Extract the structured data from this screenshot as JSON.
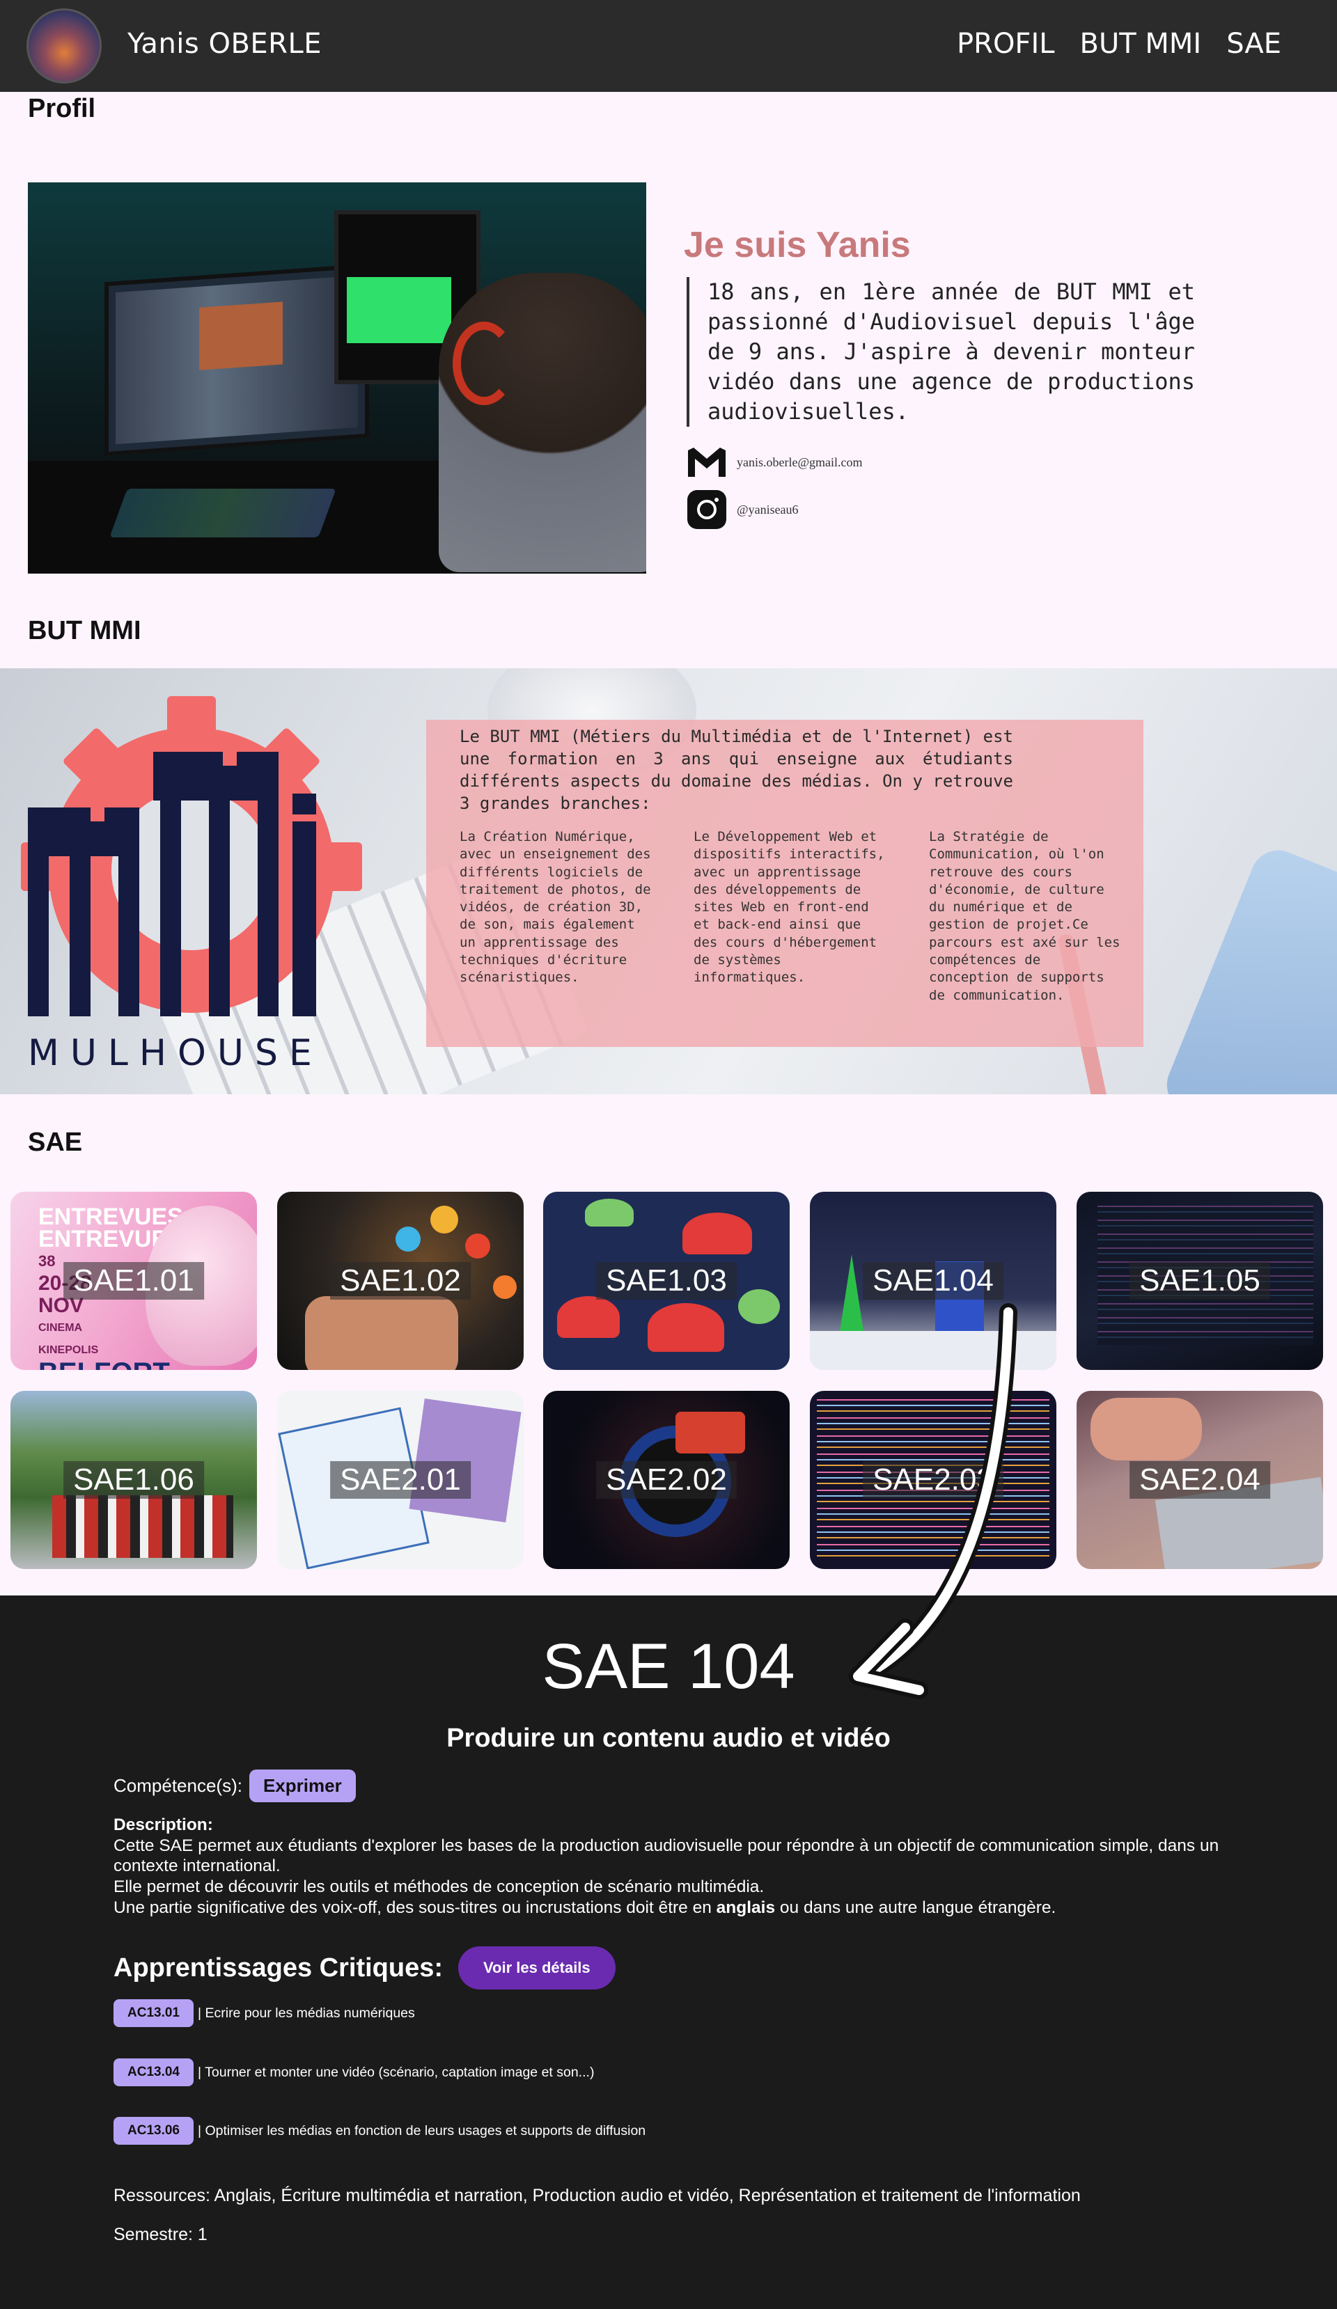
{
  "header": {
    "brand": "Yanis OBERLE",
    "nav": [
      "PROFIL",
      "BUT MMI",
      "SAE"
    ]
  },
  "profil": {
    "section_title": "Profil",
    "intro_title": "Je suis Yanis",
    "intro_text": "18 ans, en 1ère année de BUT MMI et passionné d'Audiovisuel depuis l'âge de 9 ans. J'aspire à devenir monteur vidéo dans une agence de productions audiovisuelles.",
    "email": "yanis.oberle@gmail.com",
    "instagram": "@yaniseau6"
  },
  "mmi": {
    "section_title": "BUT MMI",
    "logo_text": "MULHOUSE",
    "logo_colors": {
      "gear": "#f26a6a",
      "letters": "#141a40"
    },
    "main": "Le BUT MMI (Métiers du Multimédia et de l'Internet) est une formation en 3 ans qui enseigne aux étudiants différents aspects du domaine des médias. On y retrouve 3 grandes branches:",
    "columns": [
      "La Création Numérique, avec un enseignement des différents logiciels de traitement de photos, de vidéos, de création 3D, de son, mais également un apprentissage des techniques d'écriture scénaristiques.",
      "Le Développement Web et dispositifs interactifs, avec un apprentissage des développements de sites Web en front-end et back-end ainsi que des cours d'hébergement de systèmes informatiques.",
      "La Stratégie de Communication, où l'on retrouve des cours d'économie, de culture du numérique et de gestion de projet.Ce parcours est axé sur les compétences de conception de supports de communication."
    ]
  },
  "sae": {
    "section_title": "SAE",
    "cards": [
      "SAE1.01",
      "SAE1.02",
      "SAE1.03",
      "SAE1.04",
      "SAE1.05",
      "SAE1.06",
      "SAE2.01",
      "SAE2.02",
      "SAE2.03",
      "SAE2.04"
    ],
    "poster": {
      "line1": "ENTREVUES",
      "line2": "ENTREVUES",
      "dates": "20-28 NOV",
      "cinema": "CINEMA KINEPOLIS",
      "city": "BELFORT",
      "num": "38"
    }
  },
  "detail": {
    "title": "SAE 104",
    "subtitle": "Produire un contenu audio et vidéo",
    "competences_label": "Compétence(s):",
    "competence": "Exprimer",
    "description_label": "Description:",
    "description_lines": [
      "Cette SAE permet aux étudiants d'explorer les bases de la production audiovisuelle pour répondre à un objectif de communication simple, dans un contexte international.",
      "Elle permet de découvrir les outils et méthodes de conception de scénario multimédia."
    ],
    "desc_line3_before": "Une partie significative des voix-off, des sous-titres ou incrustations doit être en ",
    "desc_line3_bold": "anglais",
    "desc_line3_after": " ou dans une autre langue étrangère.",
    "ac_title": "Apprentissages Critiques:",
    "ac_button": "Voir les détails",
    "acs": [
      {
        "code": "AC13.01",
        "text": "| Ecrire pour les médias numériques"
      },
      {
        "code": "AC13.04",
        "text": "| Tourner et monter une vidéo (scénario, captation image et son...)"
      },
      {
        "code": "AC13.06",
        "text": "| Optimiser les médias en fonction de leurs usages et supports de diffusion"
      }
    ],
    "ressources": "Ressources: Anglais, Écriture multimédia et narration, Production audio et vidéo, Représentation et traitement de l'information",
    "semestre": "Semestre: 1"
  }
}
